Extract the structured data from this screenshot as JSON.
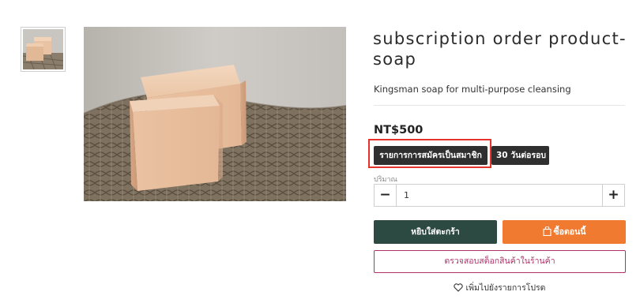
{
  "product": {
    "title": "subscription order product-soap",
    "subtitle": "Kingsman soap for multi-purpose cleansing",
    "price": "NT$500"
  },
  "options": {
    "selected": "รายการการสมัครเป็นสมาชิก",
    "cycle": "30 วันต่อรอบ"
  },
  "quantity": {
    "label": "ปริมาณ",
    "value": "1",
    "minus": "−",
    "plus": "+"
  },
  "actions": {
    "add_to_cart": "หยิบใส่ตะกร้า",
    "buy_now": "ซื้อตอนนี้",
    "check_stock": "ตรวจสอบสต็อกสินค้าในร้านค้า",
    "wishlist": "เพิ่มไปยังรายการโปรด"
  },
  "icons": {
    "bag": "shopping-bag-icon",
    "heart": "heart-icon"
  },
  "colors": {
    "cart_button": "#2c4a42",
    "buy_button": "#f07a30",
    "stock_border": "#b0306a",
    "highlight": "#e5322a",
    "option_bg": "#2f2f2f"
  }
}
